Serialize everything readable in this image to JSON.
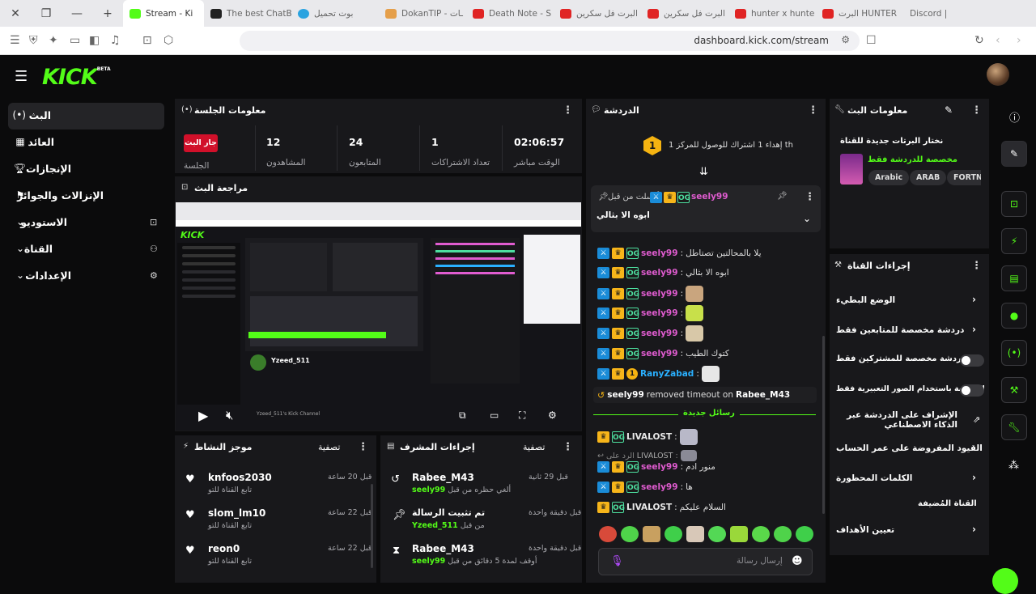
{
  "browser": {
    "tabs": [
      {
        "label": "Stream - Ki",
        "color": "#53fc18",
        "active": true
      },
      {
        "label": "The best ChatB",
        "color": "#222222"
      },
      {
        "label": "بوت تحميل",
        "color": "#2aa3e0"
      },
      {
        "label": "DokanTIP - ـات",
        "color": "#e59f4a"
      },
      {
        "label": "Death Note - S",
        "color": "#e02424"
      },
      {
        "label": "البرت فل سكرين",
        "color": "#e02424"
      },
      {
        "label": "البرت فل سكرين",
        "color": "#e02424"
      },
      {
        "label": "hunter x hunte",
        "color": "#e02424"
      },
      {
        "label": "البرت HUNTER",
        "color": "#e02424"
      },
      {
        "label": "Discord |",
        "color": "#e02424"
      }
    ],
    "url": "dashboard.kick.com/stream"
  },
  "app": {
    "logo": "KICK",
    "logo_sup": "BETA"
  },
  "sidebar": {
    "items": [
      {
        "label": "البث",
        "icon": "broadcast-icon",
        "active": true
      },
      {
        "label": "العائد",
        "icon": "revenue-icon"
      },
      {
        "label": "الإنجازات",
        "icon": "trophy-icon"
      },
      {
        "label": "الإنزالات والجوائز",
        "icon": "drops-icon"
      },
      {
        "label": "الاستوديو",
        "icon": "studio-icon",
        "expandable": true
      },
      {
        "label": "القناة",
        "icon": "channel-icon",
        "expandable": true
      },
      {
        "label": "الإعدادات",
        "icon": "settings-icon",
        "expandable": true
      }
    ]
  },
  "session": {
    "title": "معلومات الجلسة",
    "live_badge": "جار البث",
    "session_label": "الجلسة",
    "stats": [
      {
        "value": "12",
        "label": "المشاهدون"
      },
      {
        "value": "24",
        "label": "المتابعون"
      },
      {
        "value": "1",
        "label": "تعداد الاشتراكات"
      },
      {
        "value": "02:06:57",
        "label": "الوقت مباشر"
      }
    ]
  },
  "preview": {
    "title": "مراجعة البث",
    "stream_name": "Yzeed_511",
    "channel_desc": "Yzeed_511's Kick Channel"
  },
  "activity": {
    "title": "موجز النشاط",
    "filter": "تصفية",
    "items": [
      {
        "name": "knfoos2030",
        "sub": "تابع القناة للتو",
        "time": "قبل 20 ساعة"
      },
      {
        "name": "slom_lm10",
        "sub": "تابع القناة للتو",
        "time": "قبل 22 ساعة"
      },
      {
        "name": "reon0",
        "sub": "تابع القناة للتو",
        "time": "قبل 22 ساعة"
      }
    ]
  },
  "mod_actions": {
    "title": "إجراءات المشرف",
    "filter": "تصفية",
    "items": [
      {
        "title": "Rabee_M43",
        "sub_text": "ألغي حظره من قبل",
        "sub_user": "seely99",
        "time": "قبل 29 ثانية",
        "icon": "undo-icon"
      },
      {
        "title": "تم تثبيت الرسالة",
        "sub_text": "من قبل",
        "sub_user": "Yzeed_511",
        "time": "قبل دقيقة واحدة",
        "icon": "pin-icon"
      },
      {
        "title": "Rabee_M43",
        "sub_text": "أوقف لمدة 5 دقائق من قبل",
        "sub_user": "seely99",
        "time": "قبل دقيقة واحدة",
        "icon": "hourglass-icon"
      }
    ]
  },
  "chat": {
    "title": "الدردشة",
    "goal_text": "إهداء 1 اشتراك للوصول للمركز 1 ",
    "goal_suffix": "th",
    "goal_number": "1",
    "pinned_sender": "أرسلت من قبل",
    "pinned_user": "seely99",
    "pinned_message": "ابوه الا بثالي",
    "messages": [
      {
        "user": "seely99",
        "text": "يلا بالمحالتين تصتاطل",
        "color": "#e05cd0",
        "emote": ""
      },
      {
        "user": "seely99",
        "text": "ابوه الا بثالي",
        "color": "#e05cd0",
        "emote": ""
      },
      {
        "user": "seely99",
        "text": "",
        "color": "#e05cd0",
        "emote": "#c9a57e"
      },
      {
        "user": "seely99",
        "text": "",
        "color": "#e05cd0",
        "emote": "#c8e04a"
      },
      {
        "user": "seely99",
        "text": "",
        "color": "#e05cd0",
        "emote": "#d8c8a8"
      },
      {
        "user": "seely99",
        "text": "كتوك الطيب",
        "color": "#e05cd0",
        "emote": ""
      },
      {
        "user": "RanyZabad",
        "text": "",
        "color": "#2ab0ff",
        "emote": "#e6e6e6"
      }
    ],
    "system_message": {
      "user": "seely99",
      "text": "removed timeout on",
      "target": "Rabee_M43"
    },
    "new_messages": "رسائل جديدة",
    "new_messages_list": [
      {
        "user": "LIVALOST",
        "text": "",
        "color": "#e8e8e8",
        "emote": "#b8b8c8"
      },
      {
        "user": "seely99",
        "text": "منور ادم",
        "color": "#e05cd0",
        "emote": ""
      },
      {
        "user": "seely99",
        "text": "ها",
        "color": "#e05cd0",
        "emote": ""
      },
      {
        "user": "LIVALOST",
        "text": "السلام عليكم",
        "color": "#e8e8e8",
        "emote": ""
      }
    ],
    "reply_to": "الرد على",
    "reply_user": "LIVALOST",
    "input_placeholder": "إرسال رسالة"
  },
  "stream_info": {
    "title": "معلومات البث",
    "stream_title": "نختار البرتات جديدة للقناة",
    "category": "مخصصة للدردشة فقط",
    "tags": [
      "Arabic",
      "ARAB",
      "FORTN"
    ]
  },
  "channel_actions": {
    "title": "إجراءات القناة",
    "items": [
      {
        "label": "الوضع البطيء",
        "control": "chevron"
      },
      {
        "label": "دردشة مخصصة للمتابعين فقط",
        "control": "chevron"
      },
      {
        "label": "الدردشة مخصصة للمشتركين فقط",
        "control": "toggle"
      },
      {
        "label": "الدردشة باستخدام الصور التعبيرية فقط",
        "control": "toggle"
      },
      {
        "label": "الإشراف على الدردشة عبر الذكاء الاصطناعي",
        "control": "external"
      },
      {
        "label": "القيود المفروضة على عمر الحساب",
        "control": "chevron"
      },
      {
        "label": "الكلمات المحظورة",
        "control": "chevron"
      }
    ],
    "section_title": "القناة المُضيفة",
    "target_label": "تعيين الأهداف"
  }
}
